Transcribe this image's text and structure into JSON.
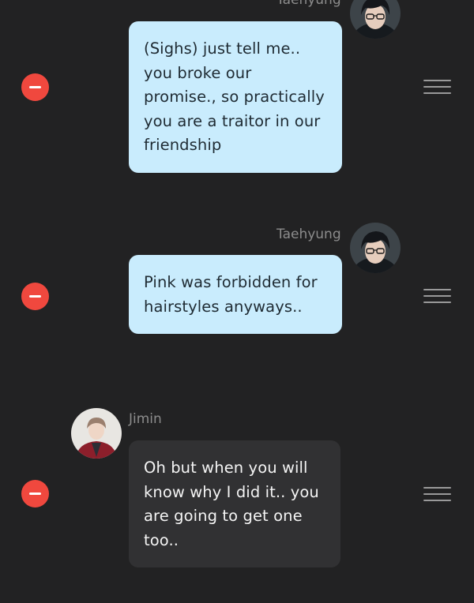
{
  "messages": [
    {
      "sender": "Taehyung",
      "text": "(Sighs) just tell me.. you broke our promise., so practically you are a traitor in our friendship",
      "lines": [
        "(Sighs) just tell me..",
        "you broke our",
        "promise., so practically",
        "you are a traitor in our",
        "friendship"
      ]
    },
    {
      "sender": "Taehyung",
      "text": "Pink was forbidden for hairstyles anyways..",
      "lines": [
        "Pink was forbidden for",
        "hairstyles anyways.."
      ]
    },
    {
      "sender": "Jimin",
      "text": "Oh but when you will know why I did it.. you are going to get one too..",
      "lines": [
        "Oh but when you will",
        "know why I did it.. you",
        "are going to get one",
        "too.."
      ]
    }
  ],
  "colors": {
    "background": "#222223",
    "delete_button": "#f0483e",
    "light_bubble": "#c9ecfd",
    "dark_bubble": "#313133",
    "name_text": "#8c8c8c"
  },
  "icons": {
    "delete": "minus-circle-icon",
    "reorder": "drag-handle-icon"
  }
}
